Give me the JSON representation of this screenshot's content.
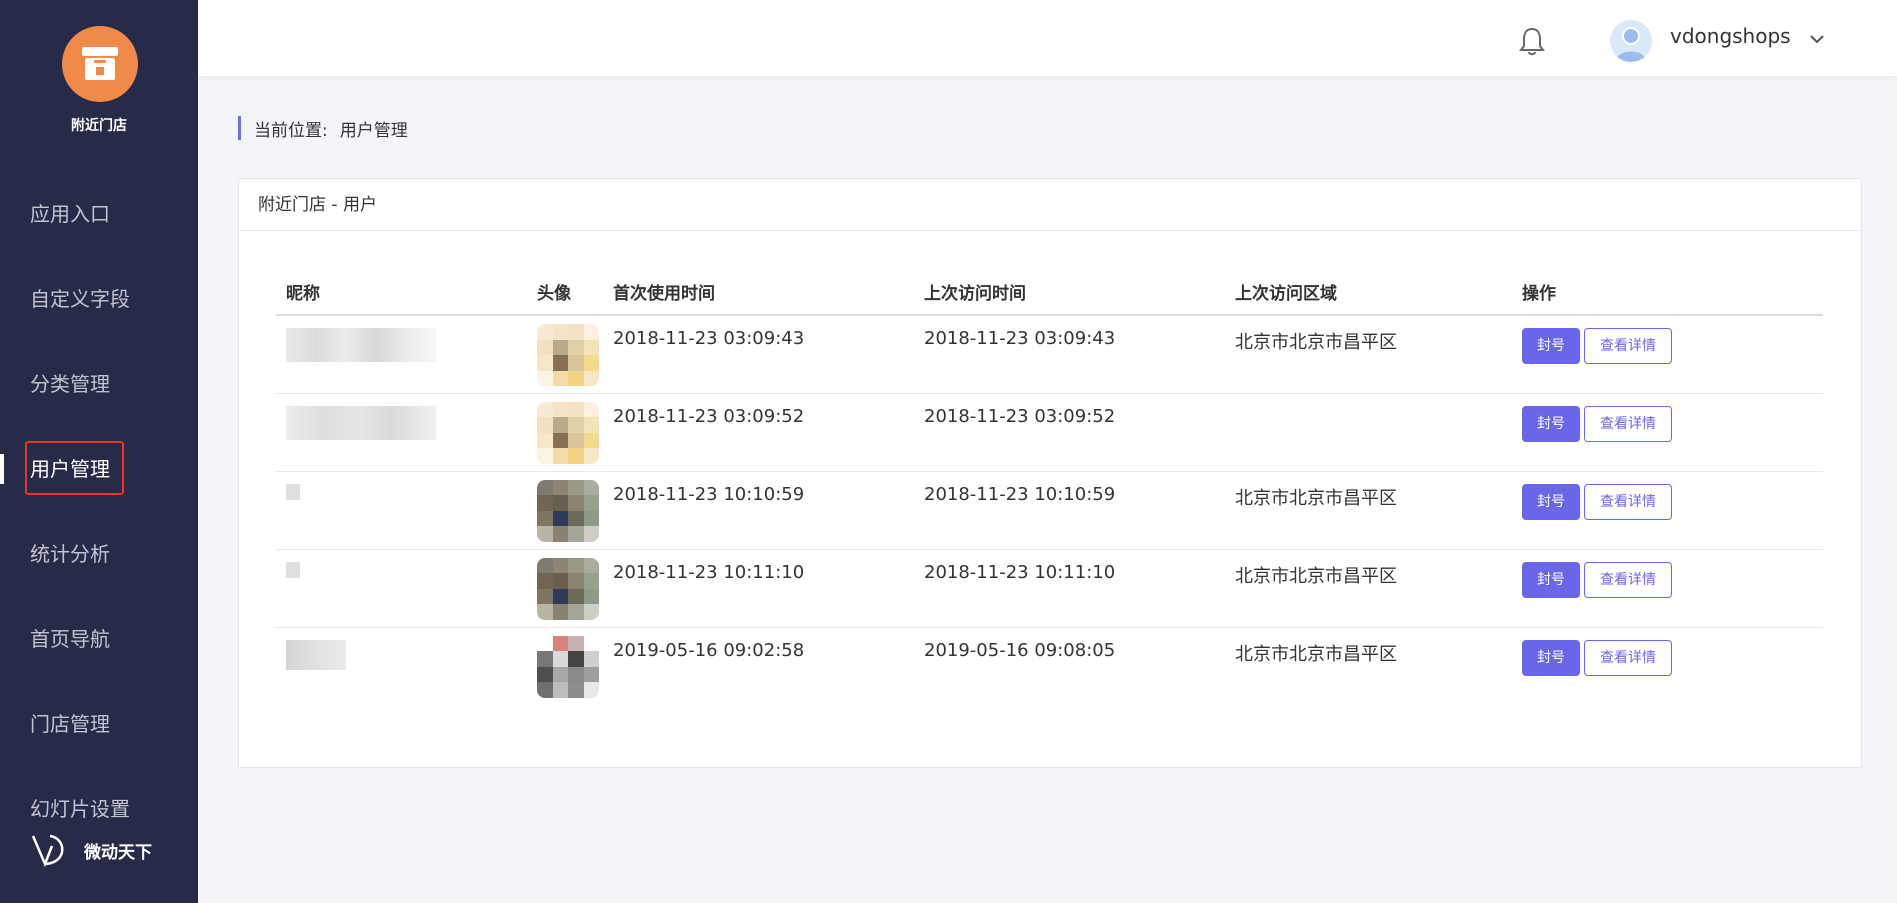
{
  "sidebar": {
    "store_name": "附近门店",
    "items": [
      {
        "label": "应用入口"
      },
      {
        "label": "自定义字段"
      },
      {
        "label": "分类管理"
      },
      {
        "label": "用户管理",
        "active": true
      },
      {
        "label": "统计分析"
      },
      {
        "label": "首页导航"
      },
      {
        "label": "门店管理"
      },
      {
        "label": "幻灯片设置"
      }
    ],
    "brand": "微动天下"
  },
  "header": {
    "username": "vdongshops",
    "icons": [
      "bell-icon",
      "user-avatar",
      "chevron-down-icon"
    ]
  },
  "breadcrumb": {
    "prefix": "当前位置:",
    "current": "用户管理"
  },
  "card": {
    "title": "附近门店 - 用户",
    "columns": [
      "昵称",
      "头像",
      "首次使用时间",
      "上次访问时间",
      "上次访问区域",
      "操作"
    ],
    "rows": [
      {
        "first": "2018-11-23 03:09:43",
        "last": "2018-11-23 03:09:43",
        "region": "北京市北京市昌平区"
      },
      {
        "first": "2018-11-23 03:09:52",
        "last": "2018-11-23 03:09:52",
        "region": ""
      },
      {
        "first": "2018-11-23 10:10:59",
        "last": "2018-11-23 10:10:59",
        "region": "北京市北京市昌平区"
      },
      {
        "first": "2018-11-23 10:11:10",
        "last": "2018-11-23 10:11:10",
        "region": "北京市北京市昌平区"
      },
      {
        "first": "2019-05-16 09:02:58",
        "last": "2019-05-16 09:08:05",
        "region": "北京市北京市昌平区"
      }
    ],
    "ban_label": "封号",
    "detail_label": "查看详情"
  },
  "colors": {
    "sidebar_bg": "#272b48",
    "accent": "#6a66e8",
    "logo_orange": "#f08a4b",
    "highlight_red": "#e8322f"
  }
}
